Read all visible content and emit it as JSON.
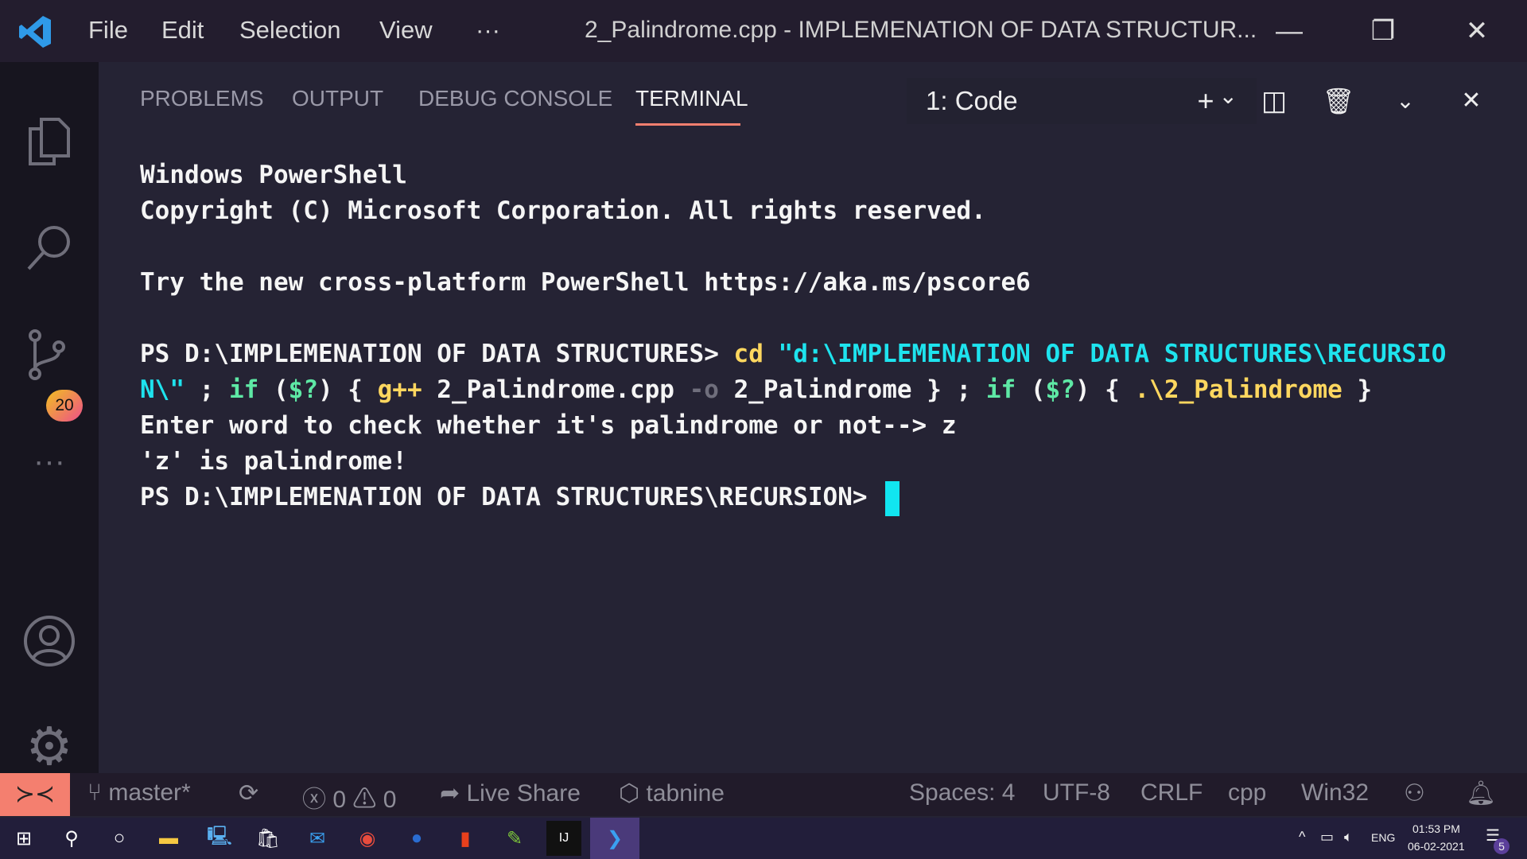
{
  "titlebar": {
    "menu": [
      "File",
      "Edit",
      "Selection",
      "View",
      "···"
    ],
    "title": "2_Palindrome.cpp - IMPLEMENATION OF DATA STRUCTUR..."
  },
  "activity": {
    "scm_badge": "20"
  },
  "panel": {
    "tabs": [
      "PROBLEMS",
      "OUTPUT",
      "DEBUG CONSOLE",
      "TERMINAL"
    ],
    "active_tab": "TERMINAL",
    "terminal_select": "1: Code"
  },
  "terminal": {
    "l1": "Windows PowerShell",
    "l2": "Copyright (C) Microsoft Corporation. All rights reserved.",
    "l3": "Try the new cross-platform PowerShell https://aka.ms/pscore6",
    "p1": "PS D:\\IMPLEMENATION OF DATA STRUCTURES> ",
    "cd": "cd",
    "path1": " \"d:\\IMPLEMENATION OF DATA STRUCTURES\\RECURSIO",
    "path2": "N\\\"",
    "semi1": " ; ",
    "if1": "if",
    "paren1": " (",
    "q1": "$?",
    "brace1": ") { ",
    "gpp": "g++",
    "file": " 2_Palindrome.cpp ",
    "opt": "-o",
    "out": " 2_Palindrome } ; ",
    "if2": "if",
    "paren2": " (",
    "q2": "$?",
    "brace2": ") { ",
    "exe": ".\\2_Palindrome",
    "close": " }",
    "l6": "Enter word to check whether it's palindrome or not--> z",
    "l7": "'z' is palindrome!",
    "p2": "PS D:\\IMPLEMENATION OF DATA STRUCTURES\\RECURSION> "
  },
  "status": {
    "branch": "master*",
    "errors": "0",
    "warnings": "0",
    "liveshare": "Live Share",
    "tabnine": "tabnine",
    "spaces": "Spaces: 4",
    "encoding": "UTF-8",
    "eol": "CRLF",
    "lang": "cpp",
    "platform": "Win32"
  },
  "taskbar": {
    "lang": "ENG",
    "time": "01:53 PM",
    "date": "06-02-2021",
    "notifications": "5"
  }
}
